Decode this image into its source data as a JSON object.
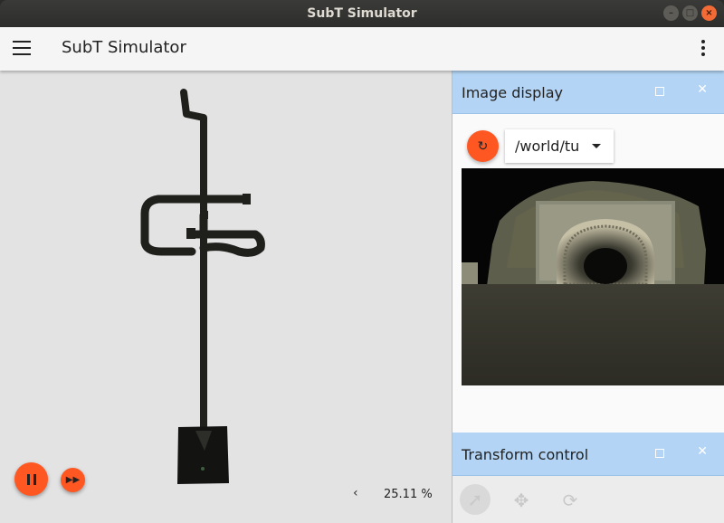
{
  "window": {
    "title": "SubT Simulator",
    "controls": [
      "minimize-icon",
      "maximize-icon",
      "close-icon"
    ]
  },
  "appbar": {
    "title": "SubT Simulator",
    "menu_icon": "hamburger-menu-icon",
    "overflow_icon": "kebab-menu-icon"
  },
  "viewport": {
    "play_pause_icon": "pause-icon",
    "step_icon": "fast-forward-icon",
    "rtf_toggle_icon": "chevron-left-icon",
    "real_time_factor": "25.11 %"
  },
  "image_display": {
    "title": "Image display",
    "refresh_icon": "refresh-icon",
    "topic": "/world/tu",
    "maximize_icon": "square-icon",
    "close_icon": "close-icon"
  },
  "transform_control": {
    "title": "Transform control",
    "tools": [
      "select-arrow-icon",
      "translate-move-icon",
      "rotate-icon"
    ]
  },
  "colors": {
    "accent": "#ff5722",
    "panel_header": "#b3d4f4",
    "viewport_bg": "#e3e3e3"
  }
}
